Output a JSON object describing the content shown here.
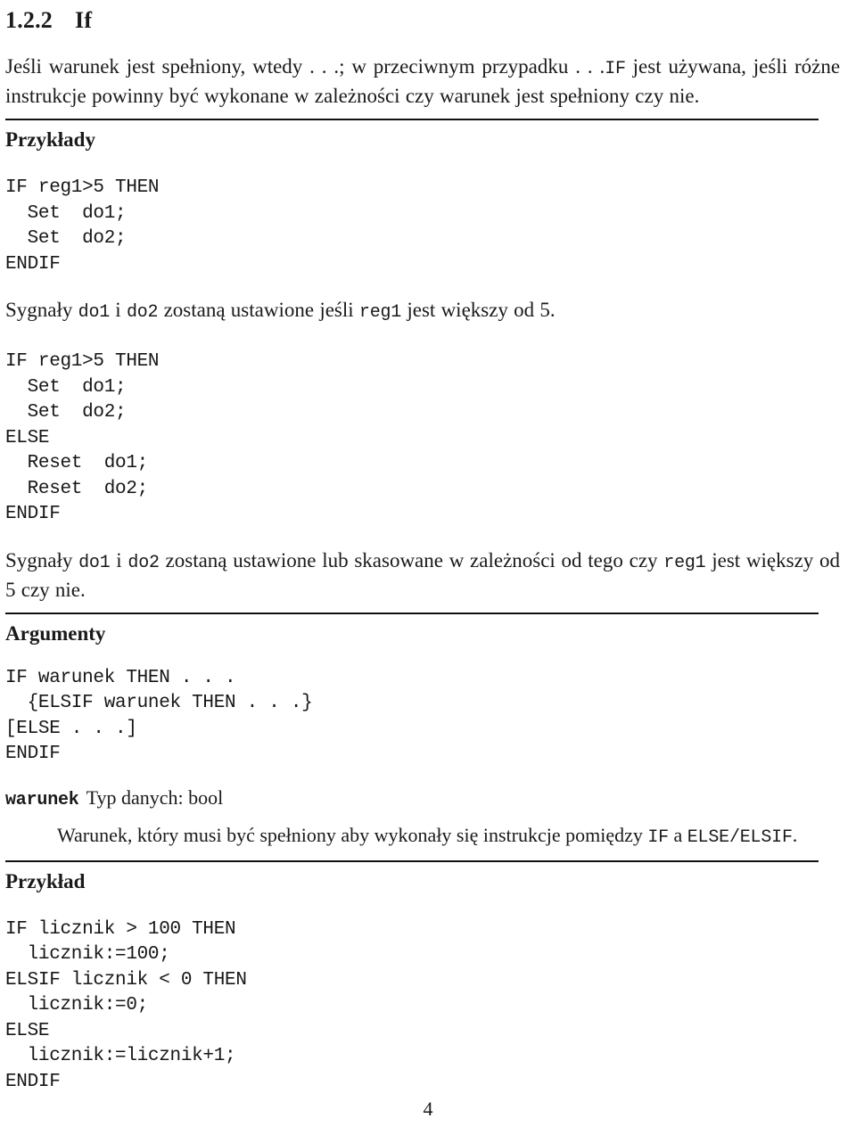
{
  "document": {
    "language": "pl",
    "page_number": "4"
  },
  "heading": {
    "number": "1.2.2",
    "title": "If"
  },
  "intro": {
    "part1": "Jeśli warunek jest spełniony, wtedy ",
    "ellipsis1": ". . .",
    "part2": "; w przeciwnym przypadku ",
    "ellipsis2": ". . .",
    "code_if": "IF",
    "part3": " jest używana, jeśli różne instrukcje powinny być wykonane w zależności czy warunek jest spełniony czy nie."
  },
  "sections": {
    "examples_heading": "Przykłady",
    "arguments_heading": "Argumenty",
    "example_heading": "Przykład"
  },
  "code_blocks": {
    "example1": "IF reg1>5 THEN\n  Set  do1;\n  Set  do2;\nENDIF",
    "example2": "IF reg1>5 THEN\n  Set  do1;\n  Set  do2;\nELSE\n  Reset  do1;\n  Reset  do2;\nENDIF",
    "syntax": "IF warunek THEN . . .\n  {ELSIF warunek THEN . . .}\n[ELSE . . .]\nENDIF",
    "example3": "IF licznik > 100 THEN\n  licznik:=100;\nELSIF licznik < 0 THEN\n  licznik:=0;\nELSE\n  licznik:=licznik+1;\nENDIF"
  },
  "descriptions": {
    "desc1_a": "Sygnały ",
    "desc1_do1": "do1",
    "desc1_b": " i ",
    "desc1_do2": "do2",
    "desc1_c": " zostaną ustawione jeśli ",
    "desc1_reg1": "reg1",
    "desc1_d": " jest większy od 5.",
    "desc2_a": "Sygnały ",
    "desc2_do1": "do1",
    "desc2_b": " i ",
    "desc2_do2": "do2",
    "desc2_c": " zostaną ustawione lub skasowane w zależności od tego czy ",
    "desc2_reg1": "reg1",
    "desc2_d": " jest większy od 5 czy nie."
  },
  "argument": {
    "name": "warunek",
    "type_label": "Typ danych: bool",
    "description_a": "Warunek, który musi być spełniony aby wykonały się instrukcje pomiędzy ",
    "description_if": "IF",
    "description_b": " a ",
    "description_else": "ELSE/ELSIF",
    "description_c": "."
  },
  "colors": {
    "text": "#1a1a1a",
    "rule": "#111111",
    "background": "#ffffff"
  }
}
